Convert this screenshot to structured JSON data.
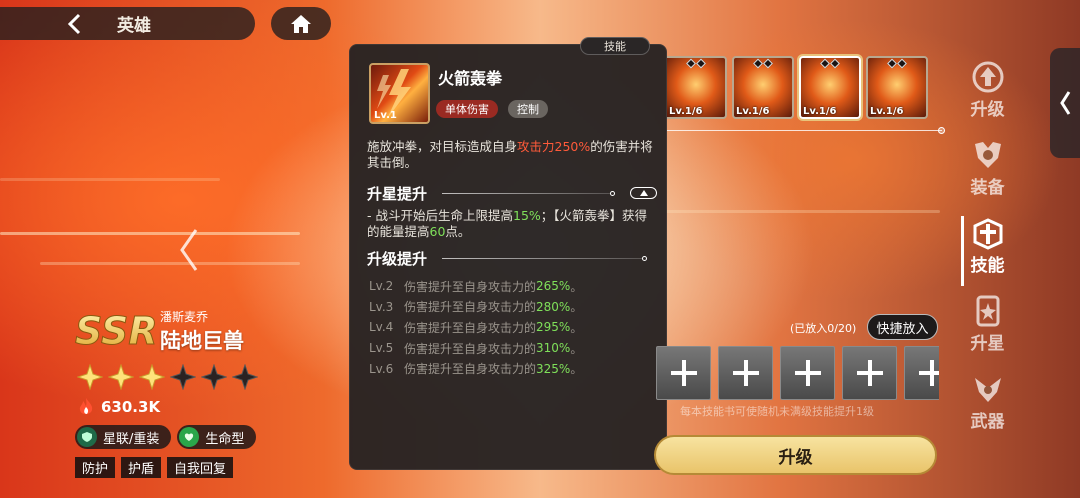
{
  "header": {
    "title": "英雄"
  },
  "hero": {
    "rarity": "SSR",
    "subtitle": "潘斯麦乔",
    "name": "陆地巨兽",
    "stars_filled": 3,
    "stars_total": 6,
    "power": "630.3K",
    "tags": [
      "星联/重装",
      "生命型"
    ],
    "chips": [
      "防护",
      "护盾",
      "自我回复"
    ]
  },
  "popup": {
    "tab_label": "技能",
    "skill": {
      "level": "Lv.1",
      "name": "火箭轰拳",
      "tags": [
        "单体伤害",
        "控制"
      ],
      "desc_pre": "施放冲拳，对目标造成自身",
      "desc_highlight": "攻击力250%",
      "desc_post": "的伤害并将其击倒。"
    },
    "star_section": {
      "title": "升星提升",
      "text_1": "- 战斗开始后生命上限提高",
      "value_1": "15%",
      "text_2": "；【火箭轰拳】获得的能量提高",
      "value_2": "60",
      "text_3": "点。"
    },
    "upgrade_section": {
      "title": "升级提升",
      "rows": [
        {
          "lv": "Lv.2",
          "pre": "伤害提升至自身攻击力的",
          "val": "265%",
          "post": "。"
        },
        {
          "lv": "Lv.3",
          "pre": "伤害提升至自身攻击力的",
          "val": "280%",
          "post": "。"
        },
        {
          "lv": "Lv.4",
          "pre": "伤害提升至自身攻击力的",
          "val": "295%",
          "post": "。"
        },
        {
          "lv": "Lv.5",
          "pre": "伤害提升至自身攻击力的",
          "val": "310%",
          "post": "。"
        },
        {
          "lv": "Lv.6",
          "pre": "伤害提升至自身攻击力的",
          "val": "325%",
          "post": "。"
        }
      ]
    }
  },
  "skill_strip": [
    {
      "level": "Lv.1/6",
      "selected": false
    },
    {
      "level": "Lv.1/6",
      "selected": false
    },
    {
      "level": "Lv.1/6",
      "selected": true
    },
    {
      "level": "Lv.1/6",
      "selected": false
    }
  ],
  "book_slots": {
    "count_label": "(已放入0/20)",
    "quick_button": "快捷放入",
    "hint": "每本技能书可使随机未满级技能提升1级"
  },
  "upgrade_button": "升级",
  "sidenav": [
    {
      "label": "升级",
      "icon": "level-up-icon",
      "active": false
    },
    {
      "label": "装备",
      "icon": "equipment-icon",
      "active": false
    },
    {
      "label": "技能",
      "icon": "skill-icon",
      "active": true
    },
    {
      "label": "升星",
      "icon": "star-up-icon",
      "active": false
    },
    {
      "label": "武器",
      "icon": "weapon-icon",
      "active": false
    }
  ],
  "colors": {
    "accent_gold": "#e9c46a",
    "highlight_red": "#ff5a3a",
    "highlight_green": "#7fe05a"
  }
}
